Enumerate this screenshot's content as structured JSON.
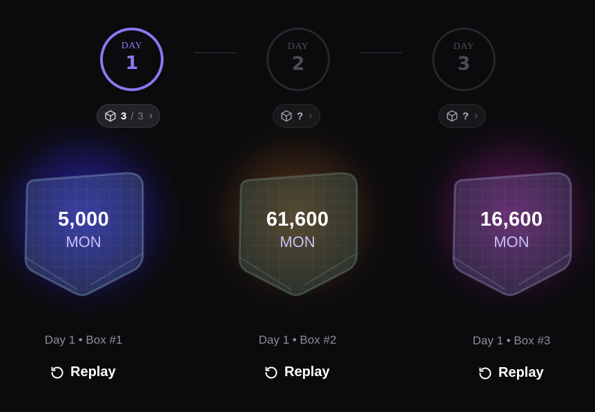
{
  "days": [
    {
      "label": "DAY",
      "number": "1",
      "state": "active"
    },
    {
      "label": "DAY",
      "number": "2",
      "state": "locked"
    },
    {
      "label": "DAY",
      "number": "3",
      "state": "locked"
    }
  ],
  "pills": [
    {
      "count": "3",
      "separator": "/",
      "total": "3",
      "icon": "cube-icon",
      "chevron": "chevron-right-icon"
    },
    {
      "count": "?",
      "icon": "cube-icon",
      "chevron": "chevron-right-icon"
    },
    {
      "count": "?",
      "icon": "cube-icon",
      "chevron": "chevron-right-icon"
    }
  ],
  "boxes": [
    {
      "amount": "5,000",
      "unit": "MON",
      "caption": "Day 1 • Box #1",
      "replay_label": "Replay",
      "glow_color": "#3c32e6"
    },
    {
      "amount": "61,600",
      "unit": "MON",
      "caption": "Day 1 • Box #2",
      "replay_label": "Replay",
      "glow_color": "#aa641e"
    },
    {
      "amount": "16,600",
      "unit": "MON",
      "caption": "Day 1 • Box #3",
      "replay_label": "Replay",
      "glow_color": "#aa1e96"
    }
  ],
  "colors": {
    "accent": "#8a78f0",
    "background": "#0b0b0e",
    "unit_text": "#c8c0f8"
  }
}
